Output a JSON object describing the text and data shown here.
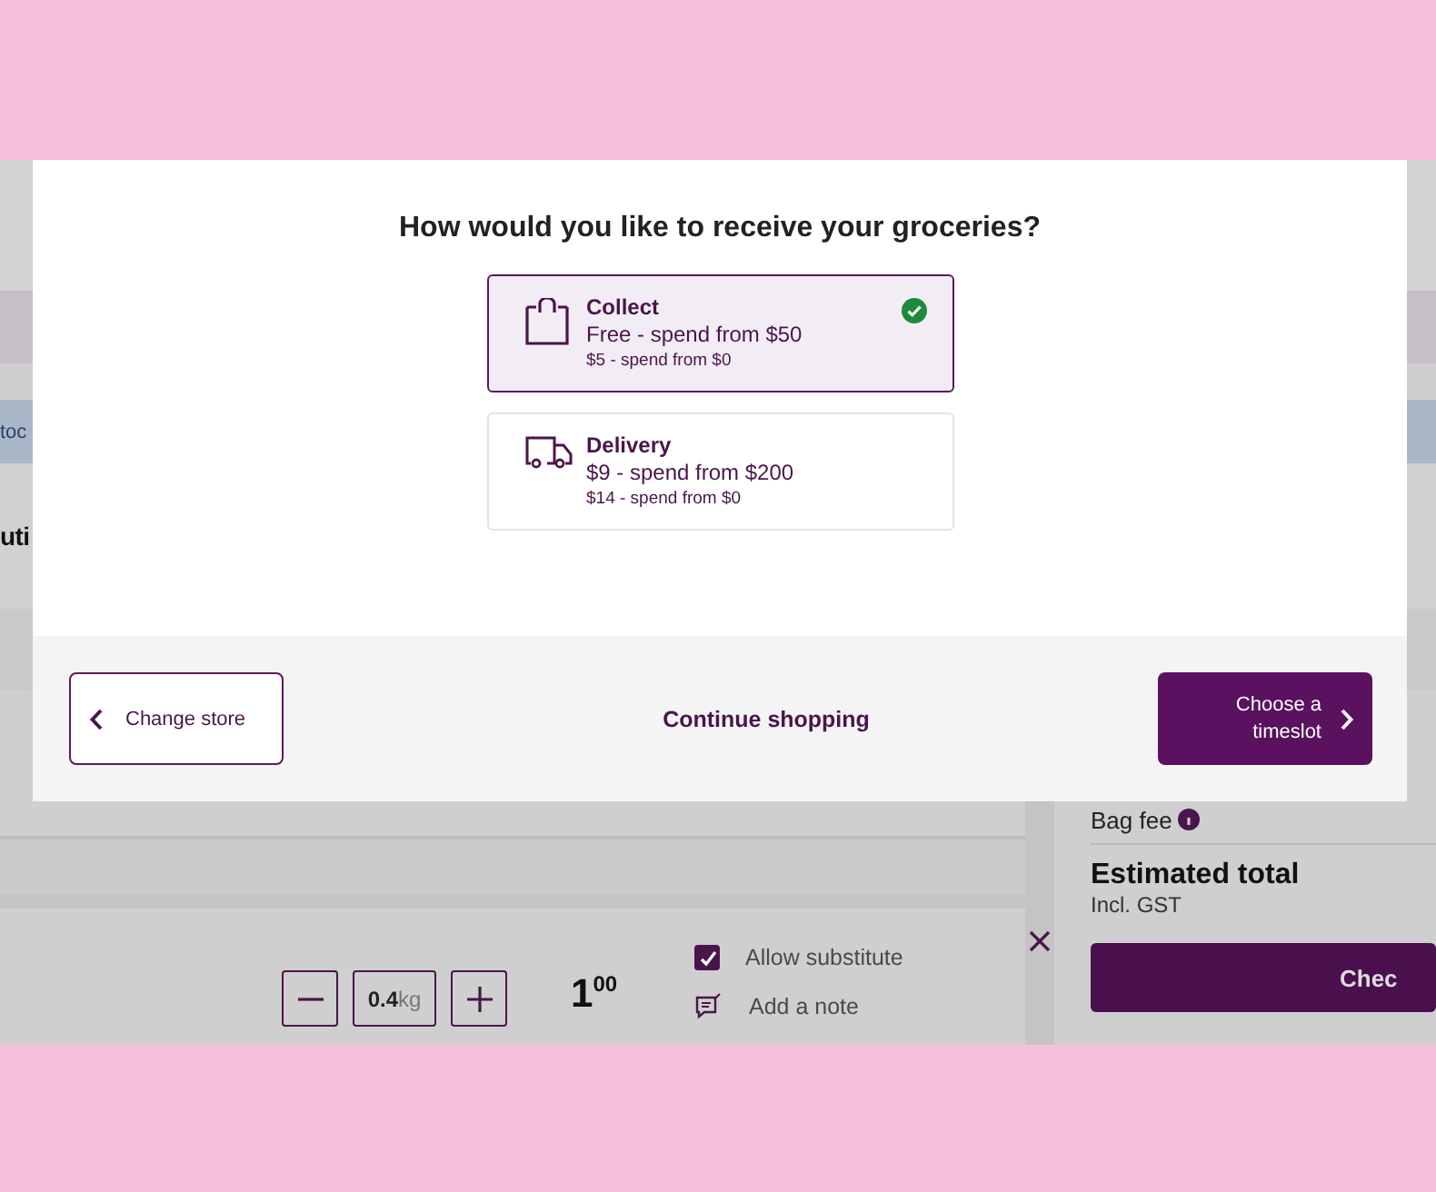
{
  "page": {
    "banner_text": "toc",
    "heading": "uti",
    "item": {
      "quantity": "0.4",
      "unit": "kg",
      "price_whole": "1",
      "price_cents": "00",
      "substitute": {
        "label": "Allow substitute",
        "checked": true
      },
      "note": "Add a note"
    },
    "summary": {
      "bag_fee": "Bag fee",
      "total_label": "Estimated total",
      "total_note": "Incl. GST",
      "checkout": "Chec"
    }
  },
  "modal": {
    "title": "How would you like to receive your groceries?",
    "options": [
      {
        "kind": "collect",
        "name": "Collect",
        "price": "Free - spend from $50",
        "alt_price": "$5 - spend from $0",
        "selected": true
      },
      {
        "kind": "delivery",
        "name": "Delivery",
        "price": "$9 - spend from $200",
        "alt_price": "$14 - spend from $0",
        "selected": false
      }
    ],
    "back_button": "Change store",
    "link": "Continue shopping",
    "next_button": "Choose a timeslot"
  }
}
